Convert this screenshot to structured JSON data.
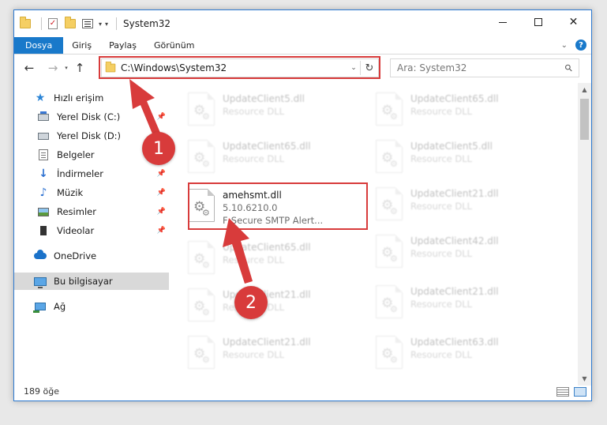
{
  "window": {
    "title": "System32",
    "quick_access_toolbar": [
      "folder-icon",
      "properties-check-icon",
      "new-folder-icon",
      "properties-icon",
      "dropdown-icon"
    ]
  },
  "ribbon": {
    "tabs": [
      {
        "label": "Dosya",
        "active": true
      },
      {
        "label": "Giriş"
      },
      {
        "label": "Paylaş"
      },
      {
        "label": "Görünüm"
      }
    ]
  },
  "navigation": {
    "address": "C:\\Windows\\System32",
    "search_placeholder": "Ara: System32"
  },
  "sidebar": {
    "items": [
      {
        "label": "Hızlı erişim",
        "icon": "star-icon"
      },
      {
        "label": "Yerel Disk (C:)",
        "icon": "disk-icon",
        "pinned": true
      },
      {
        "label": "Yerel Disk (D:)",
        "icon": "disk-icon"
      },
      {
        "label": "Belgeler",
        "icon": "documents-icon",
        "pinned": true
      },
      {
        "label": "İndirmeler",
        "icon": "download-icon",
        "pinned": true
      },
      {
        "label": "Müzik",
        "icon": "music-icon",
        "pinned": true
      },
      {
        "label": "Resimler",
        "icon": "pictures-icon",
        "pinned": true
      },
      {
        "label": "Videolar",
        "icon": "videos-icon",
        "pinned": true
      },
      {
        "label": "OneDrive",
        "icon": "cloud-icon"
      },
      {
        "label": "Bu bilgisayar",
        "icon": "computer-icon",
        "selected": true
      },
      {
        "label": "Ağ",
        "icon": "network-icon"
      }
    ]
  },
  "files": {
    "left_column": [
      {
        "name": "UpdateClient5.dll",
        "sub": "Resource DLL"
      },
      {
        "name": "UpdateClient65.dll",
        "sub": "Resource DLL"
      },
      {
        "name": "amehsmt.dll",
        "version": "5.10.6210.0",
        "description": "F-Secure SMTP Alert...",
        "highlighted": true
      },
      {
        "name": "UpdateClient65.dll",
        "sub": "Resource DLL"
      },
      {
        "name": "UpdateClient21.dll",
        "sub": "Resource DLL"
      },
      {
        "name": "UpdateClient21.dll",
        "sub": "Resource DLL"
      }
    ],
    "right_column": [
      {
        "name": "UpdateClient65.dll",
        "sub": "Resource DLL"
      },
      {
        "name": "UpdateClient5.dll",
        "sub": "Resource DLL"
      },
      {
        "name": "UpdateClient21.dll",
        "sub": "Resource DLL"
      },
      {
        "name": "UpdateClient42.dll",
        "sub": "Resource DLL"
      },
      {
        "name": "UpdateClient21.dll",
        "sub": "Resource DLL"
      },
      {
        "name": "UpdateClient63.dll",
        "sub": "Resource DLL"
      }
    ]
  },
  "status": {
    "item_count": "189 öğe"
  },
  "annotations": {
    "step1": "1",
    "step2": "2",
    "color": "#d83b3b"
  }
}
